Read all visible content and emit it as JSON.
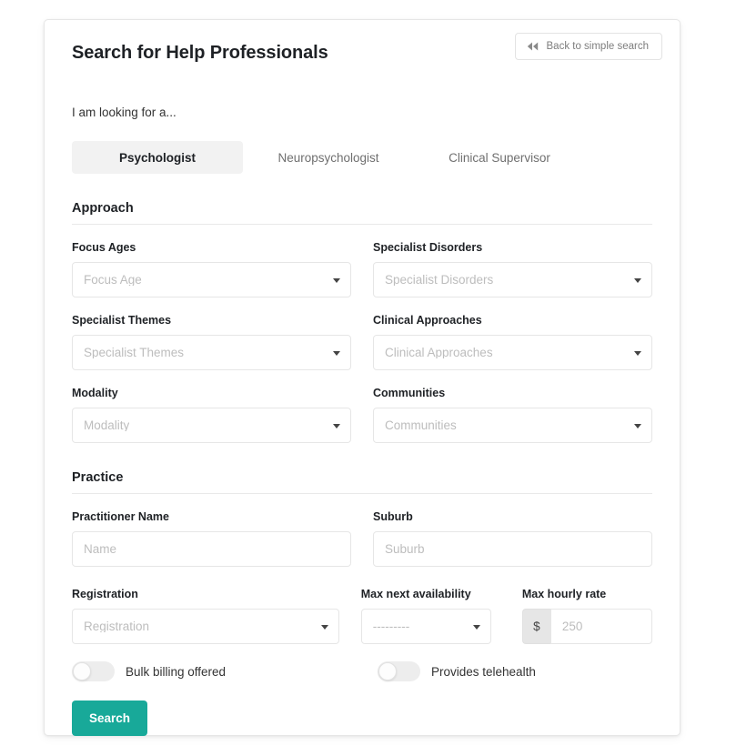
{
  "header": {
    "title": "Search for Help Professionals",
    "back_button": {
      "label": "Back to simple search",
      "icon": "rewind-double-left-icon"
    }
  },
  "looking_for": {
    "label": "I am looking for a...",
    "tabs": [
      {
        "label": "Psychologist",
        "active": true
      },
      {
        "label": "Neuropsychologist",
        "active": false
      },
      {
        "label": "Clinical Supervisor",
        "active": false
      }
    ]
  },
  "sections": {
    "approach": {
      "title": "Approach",
      "fields": {
        "focus_ages": {
          "label": "Focus Ages",
          "placeholder": "Focus Age",
          "value": "",
          "type": "select"
        },
        "specialist_disorders": {
          "label": "Specialist Disorders",
          "placeholder": "Specialist Disorders",
          "value": "",
          "type": "select"
        },
        "specialist_themes": {
          "label": "Specialist Themes",
          "placeholder": "Specialist Themes",
          "value": "",
          "type": "select"
        },
        "clinical_approaches": {
          "label": "Clinical Approaches",
          "placeholder": "Clinical Approaches",
          "value": "",
          "type": "select"
        },
        "modality": {
          "label": "Modality",
          "placeholder": "Modality",
          "value": "",
          "type": "select"
        },
        "communities": {
          "label": "Communities",
          "placeholder": "Communities",
          "value": "",
          "type": "select"
        }
      }
    },
    "practice": {
      "title": "Practice",
      "fields": {
        "practitioner_name": {
          "label": "Practitioner Name",
          "placeholder": "Name",
          "value": "",
          "type": "text"
        },
        "suburb": {
          "label": "Suburb",
          "placeholder": "Suburb",
          "value": "",
          "type": "text"
        },
        "registration": {
          "label": "Registration",
          "placeholder": "Registration",
          "value": "",
          "type": "select"
        },
        "max_next_availability": {
          "label": "Max next availability",
          "placeholder": "---------",
          "value": "---------",
          "type": "select"
        },
        "max_hourly_rate": {
          "label": "Max hourly rate",
          "prefix": "$",
          "placeholder": "250",
          "value": "",
          "type": "text"
        }
      },
      "toggles": [
        {
          "label": "Bulk billing offered",
          "on": false
        },
        {
          "label": "Provides telehealth",
          "on": false
        }
      ]
    }
  },
  "actions": {
    "search_label": "Search"
  },
  "colors": {
    "accent": "#18a999",
    "tab_active_bg": "#f2f2f2",
    "placeholder": "#bdbdbd",
    "border": "#e6e6e6",
    "prefix_bg": "#e6e6e6"
  }
}
